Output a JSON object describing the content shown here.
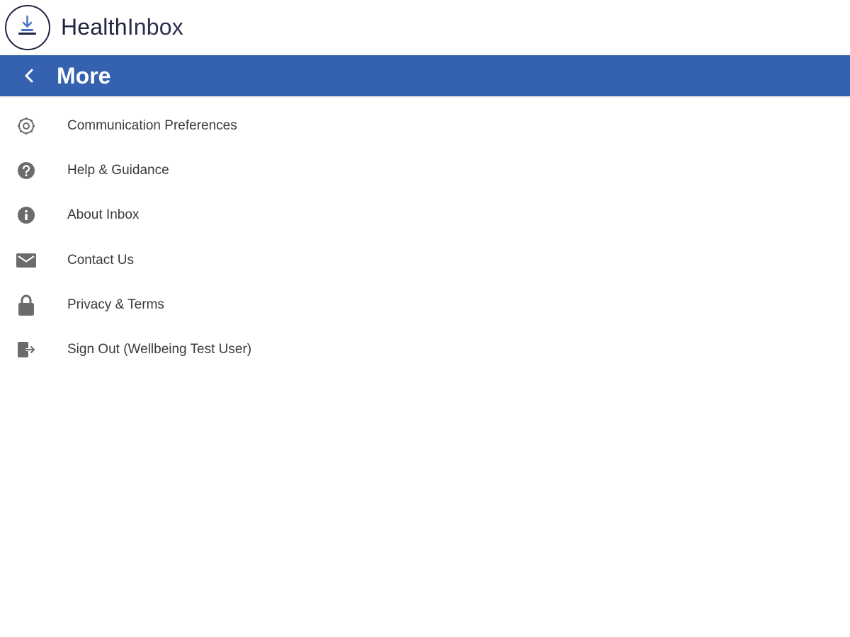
{
  "brand": {
    "name_part1": "Health",
    "name_part2": "Inbox",
    "logo_icon": "download-tray-icon"
  },
  "header": {
    "title": "More",
    "back_icon": "chevron-left-icon"
  },
  "colors": {
    "accent": "#3461b0",
    "brand_dark": "#1f2440",
    "icon_gray": "#6b6b6b",
    "text": "#3a3a3a"
  },
  "menu": {
    "items": [
      {
        "label": "Communication Preferences",
        "icon": "gear-icon"
      },
      {
        "label": "Help & Guidance",
        "icon": "question-circle-icon"
      },
      {
        "label": "About Inbox",
        "icon": "info-circle-icon"
      },
      {
        "label": "Contact Us",
        "icon": "envelope-icon"
      },
      {
        "label": "Privacy & Terms",
        "icon": "lock-icon"
      },
      {
        "label": "Sign Out (Wellbeing Test User)",
        "icon": "sign-out-icon"
      }
    ]
  }
}
